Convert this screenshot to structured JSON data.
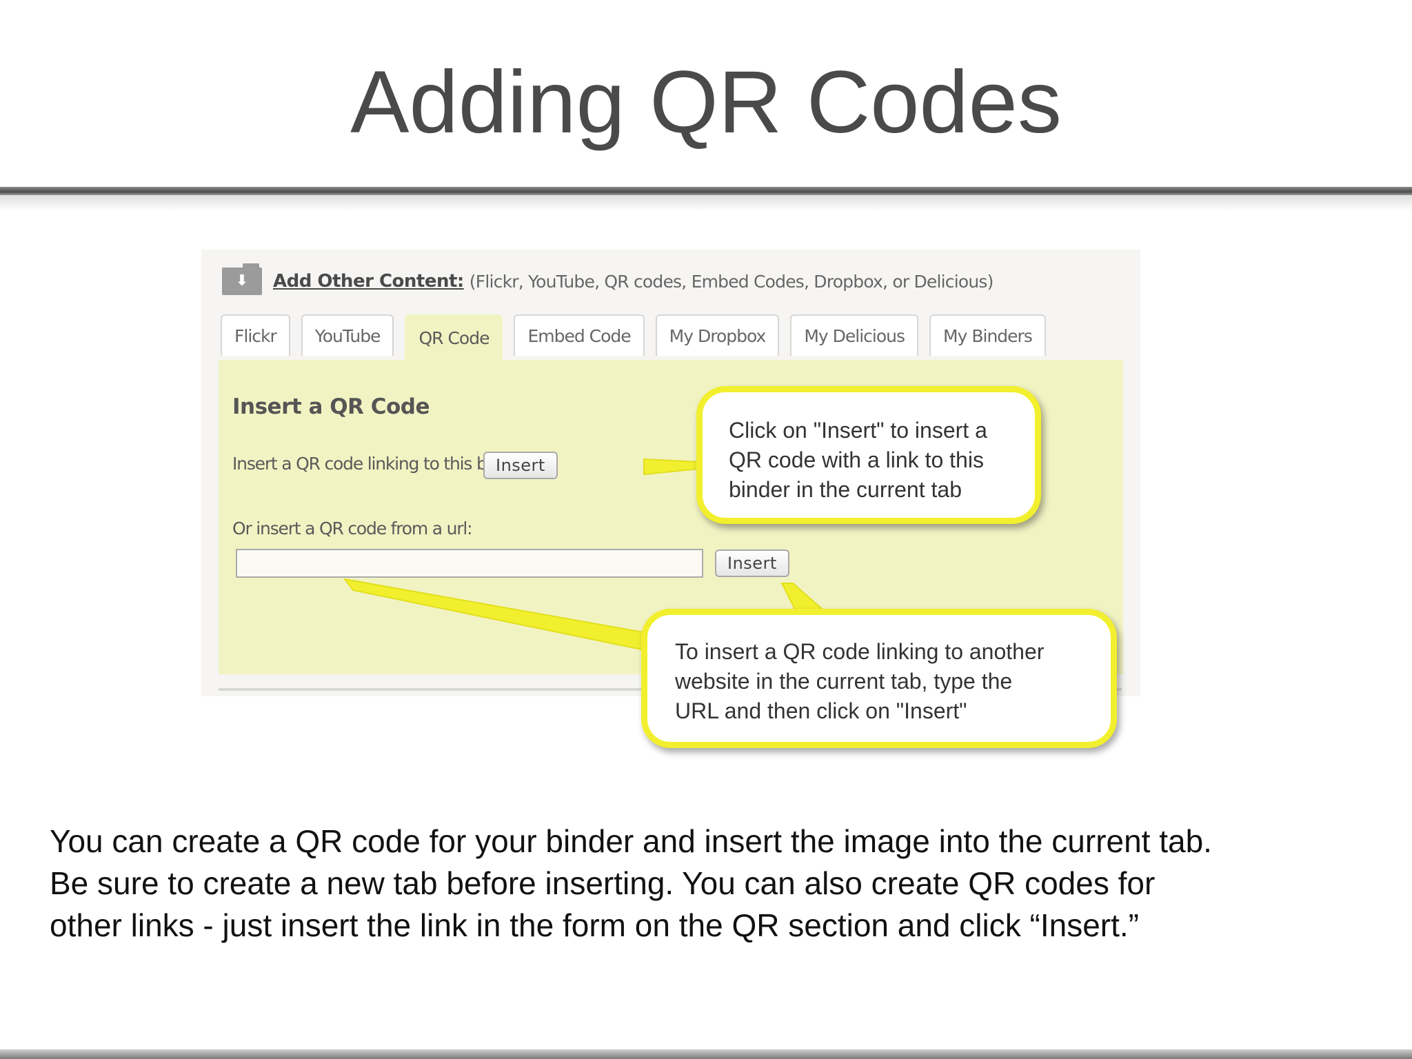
{
  "slide": {
    "title": "Adding QR Codes",
    "body_lines": [
      "You can create a QR code for your binder and insert the image into the current tab.",
      "Be sure to create a new tab before inserting. You can also create QR codes for",
      "other links - just insert the link in the form on the QR section and click “Insert.”"
    ]
  },
  "screenshot": {
    "header": {
      "icon": "folder-download-icon",
      "label": "Add Other Content:",
      "description": "(Flickr, YouTube, QR codes, Embed Codes, Dropbox, or Delicious)"
    },
    "tabs": [
      {
        "label": "Flickr",
        "active": false
      },
      {
        "label": "YouTube",
        "active": false
      },
      {
        "label": "QR Code",
        "active": true
      },
      {
        "label": "Embed Code",
        "active": false
      },
      {
        "label": "My Dropbox",
        "active": false
      },
      {
        "label": "My Delicious",
        "active": false
      },
      {
        "label": "My Binders",
        "active": false
      }
    ],
    "panel": {
      "heading": "Insert a QR Code",
      "binder_label": "Insert a QR code linking to this binder:",
      "binder_button": "Insert",
      "url_label": "Or insert a QR code from a url:",
      "url_value": "",
      "url_button": "Insert"
    },
    "callouts": {
      "binder": [
        "Click on \"Insert\" to insert a",
        "QR code with a link to this",
        "binder in the current tab"
      ],
      "url": [
        "To insert a QR code linking to another",
        "website in the current tab, type the",
        "URL and then click on \"Insert\""
      ]
    },
    "colors": {
      "panel": "#f2f3c3",
      "callout_border": "#f2ef2e",
      "title_text": "#4a4a4a"
    }
  }
}
